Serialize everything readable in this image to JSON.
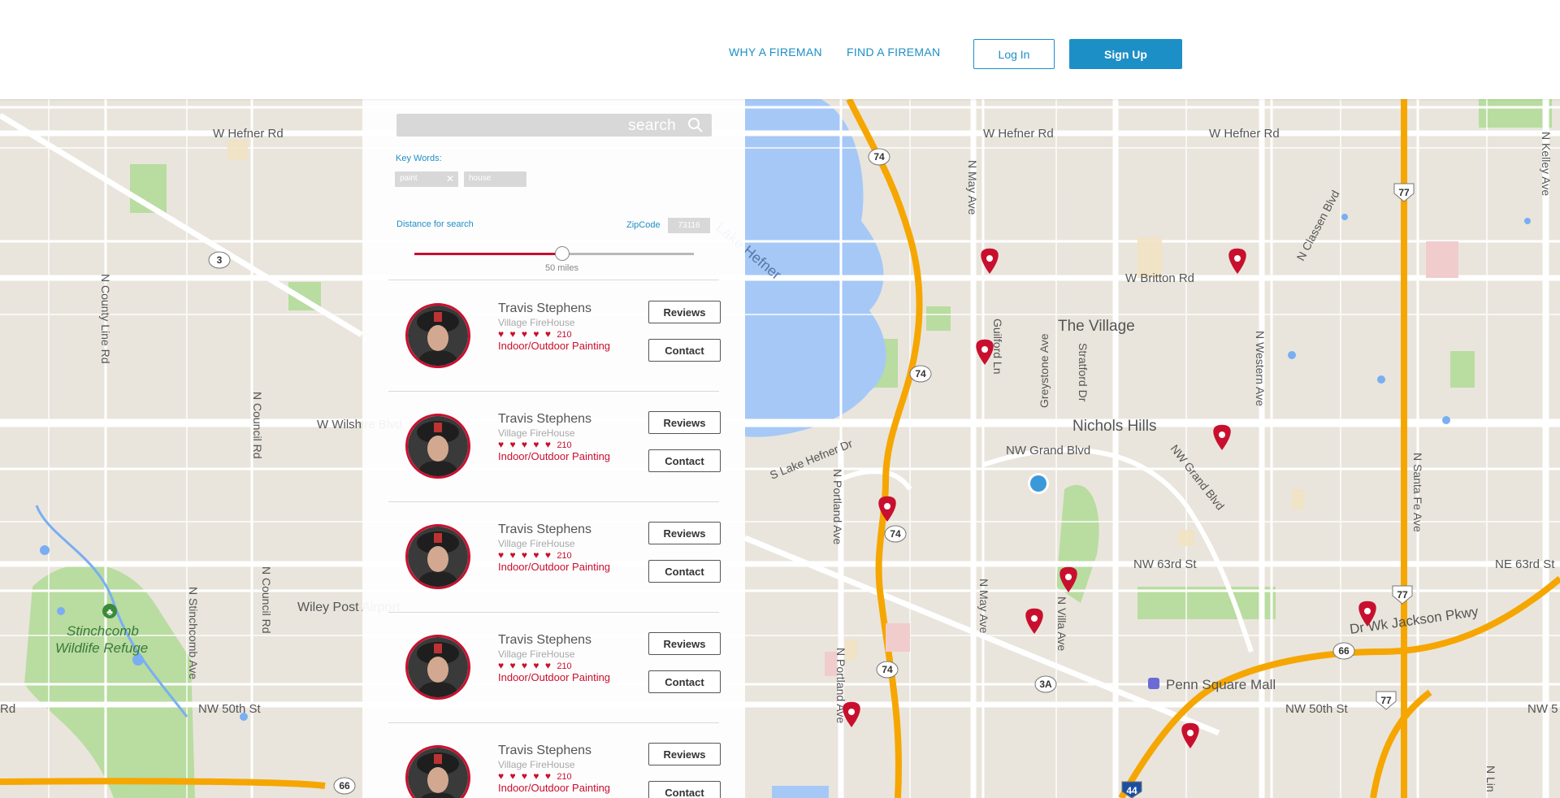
{
  "nav": {
    "links": [
      "WHY A FIREMAN",
      "FIND A FIREMAN"
    ],
    "login_label": "Log In",
    "signup_label": "Sign Up"
  },
  "search": {
    "placeholder": "search",
    "keywords_label": "Key Words:",
    "keywords": [
      "paint",
      "house"
    ],
    "distance_label": "Distance for search",
    "zipcode_label": "ZipCode",
    "zipcode_value": "73116",
    "distance_value": "50 miles",
    "slider_fraction": 0.53
  },
  "results": [
    {
      "name": "Travis Stephens",
      "station": "Village FireHouse",
      "hearts": "♥ ♥ ♥ ♥ ♥",
      "rating": "210",
      "service": "Indoor/Outdoor Painting",
      "reviews_label": "Reviews",
      "contact_label": "Contact"
    },
    {
      "name": "Travis Stephens",
      "station": "Village FireHouse",
      "hearts": "♥ ♥ ♥ ♥ ♥",
      "rating": "210",
      "service": "Indoor/Outdoor Painting",
      "reviews_label": "Reviews",
      "contact_label": "Contact"
    },
    {
      "name": "Travis Stephens",
      "station": "Village FireHouse",
      "hearts": "♥ ♥ ♥ ♥ ♥",
      "rating": "210",
      "service": "Indoor/Outdoor Painting",
      "reviews_label": "Reviews",
      "contact_label": "Contact"
    },
    {
      "name": "Travis Stephens",
      "station": "Village FireHouse",
      "hearts": "♥ ♥ ♥ ♥ ♥",
      "rating": "210",
      "service": "Indoor/Outdoor Painting",
      "reviews_label": "Reviews",
      "contact_label": "Contact"
    },
    {
      "name": "Travis Stephens",
      "station": "Village FireHouse",
      "hearts": "♥ ♥ ♥ ♥ ♥",
      "rating": "210",
      "service": "Indoor/Outdoor Painting",
      "reviews_label": "Reviews",
      "contact_label": "Contact"
    }
  ],
  "map": {
    "streets": {
      "w_hefner_rd": "W Hefner Rd",
      "w_britton_rd": "W Britton Rd",
      "w_wilshire_blvd": "W Wilshire Blvd",
      "nw_grand_blvd": "NW Grand Blvd",
      "nw_grand_blvd_diag": "NW Grand Blvd",
      "nw_63rd_st": "NW 63rd St",
      "ne_63rd_st": "NE 63rd St",
      "nw_50th_st": "NW 50th St",
      "nw_50th_st_right": "NW 50th St",
      "n_county_line_rd": "N County Line Rd",
      "n_council_rd": "N Council Rd",
      "n_council_rd_2": "N Council Rd",
      "n_stinchcomb_ave": "N Stinchcomb Ave",
      "n_may_ave": "N May Ave",
      "n_may_ave_2": "N May Ave",
      "n_portland_ave": "N Portland Ave",
      "n_portland_ave_2": "N Portland Ave",
      "guilford_ln": "Guilford Ln",
      "greystone_ave": "Greystone Ave",
      "stratford_dr": "Stratford Dr",
      "n_villa_ave": "N Villa Ave",
      "n_western_ave": "N Western Ave",
      "n_classen_blvd": "N Classen Blvd",
      "n_santa_fe_ave": "N Santa Fe Ave",
      "n_kelley_ave": "N Kelley Ave",
      "dr_wk_jackson_pkwy": "Dr Wk Jackson Pkwy",
      "lake_hefner_dr": "S Lake Hefner Dr",
      "rd_left": "Rd",
      "nw_5": "NW 5",
      "n_lin": "N Lin"
    },
    "places": {
      "the_village": "The Village",
      "nichols_hills": "Nichols Hills",
      "lake_hefner": "Lake Hefner",
      "penn_square_mall": "Penn Square Mall",
      "wiley_post_airport": "Wiley Post Airport",
      "stinchcomb": "Stinchcomb",
      "wildlife_refuge": "Wildlife Refuge"
    },
    "shields": {
      "s74a": "74",
      "s74b": "74",
      "s74c": "74",
      "s74d": "74",
      "s77a": "77",
      "s77b": "77",
      "s77c": "77",
      "s66a": "66",
      "s66b": "66",
      "s3": "3",
      "s3a": "3A",
      "s44": "44"
    }
  }
}
